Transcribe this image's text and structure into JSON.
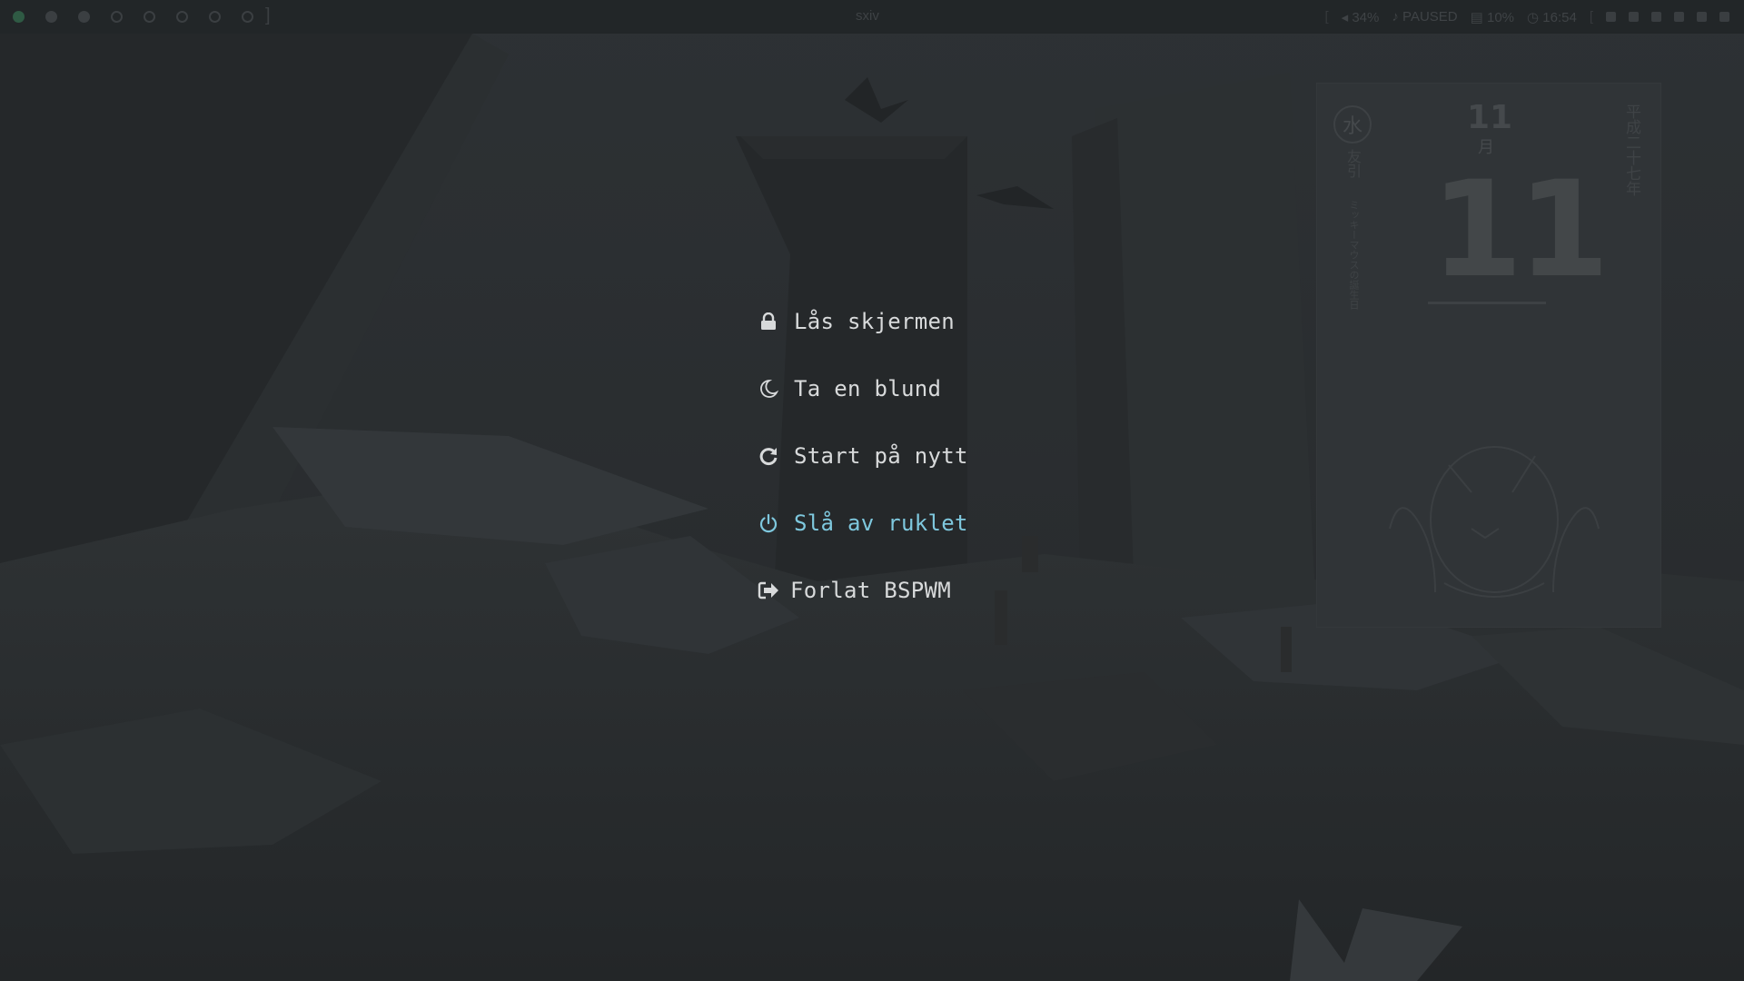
{
  "topbar": {
    "window_title": "sxiv",
    "status": {
      "volume": "34%",
      "player_state": "PAUSED",
      "memory": "10%",
      "clock": "16:54"
    }
  },
  "calendar": {
    "weekday_char": "水",
    "month_number": "11",
    "month_char": "月",
    "day_number": "11",
    "era_year": "平成二十七年",
    "rokuyo": "友引",
    "note": "ミッキーマウスの誕生日"
  },
  "power_menu": {
    "items": [
      {
        "label": "Lås skjermen",
        "icon": "lock-icon"
      },
      {
        "label": "Ta en blund",
        "icon": "moon-icon"
      },
      {
        "label": "Start på nytt",
        "icon": "refresh-icon"
      },
      {
        "label": "Slå av ruklet",
        "icon": "power-icon"
      },
      {
        "label": "Forlat BSPWM",
        "icon": "sign-out-icon"
      }
    ],
    "selected_index": 3
  },
  "colors": {
    "background": "#2a2e31",
    "text": "#d8dadb",
    "accent": "#7ec8de",
    "workspace_active": "#2f5a44"
  }
}
